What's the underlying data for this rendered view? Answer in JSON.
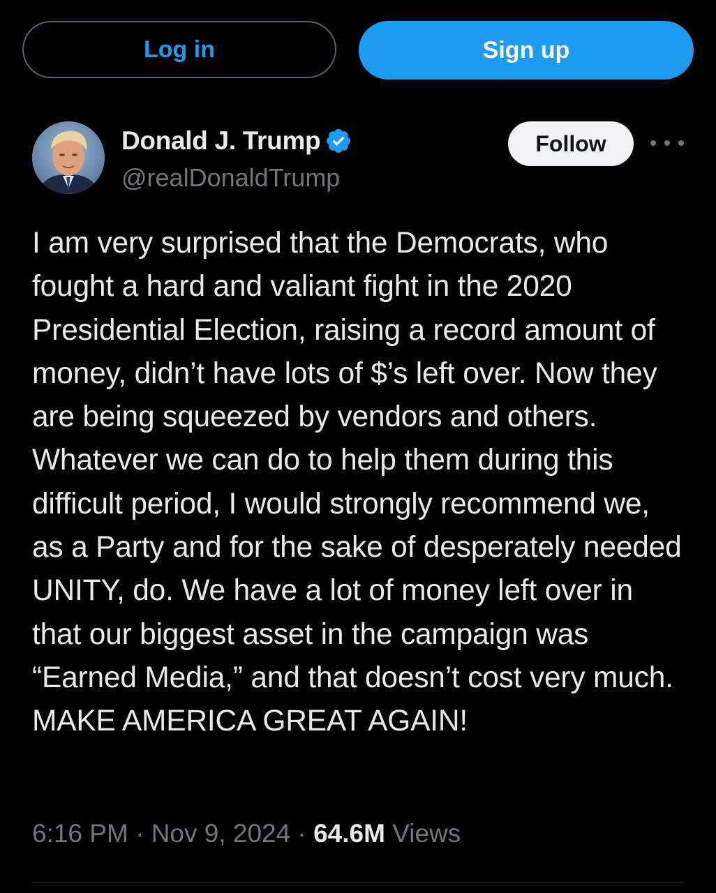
{
  "auth": {
    "login_label": "Log in",
    "signup_label": "Sign up"
  },
  "tweet": {
    "author": {
      "display_name": "Donald J. Trump",
      "handle": "@realDonaldTrump",
      "verified_icon": "verified-badge-icon",
      "avatar": "avatar-photo"
    },
    "follow_label": "Follow",
    "more_icon": "more-options-icon",
    "text": "I am very surprised that the Democrats, who fought a hard and valiant fight in the 2020 Presidential Election, raising a record amount of money, didn’t have lots of $’s left over. Now they are being squeezed by vendors and others. Whatever we can do to help them during this difficult period, I would strongly recommend we, as a Party and for the sake of desperately needed UNITY, do. We have a lot of money left over in that our biggest asset in the campaign was “Earned Media,” and that doesn’t cost very much. MAKE AMERICA GREAT AGAIN!",
    "time": "6:16 PM",
    "separator": " · ",
    "date": "Nov 9, 2024",
    "views_count": "64.6M",
    "views_label": "Views"
  },
  "colors": {
    "background": "#000000",
    "accent_blue": "#1d9bf0",
    "primary_text": "#e7e9ea",
    "secondary_text": "#71767b",
    "follow_bg": "#eff3f4"
  }
}
